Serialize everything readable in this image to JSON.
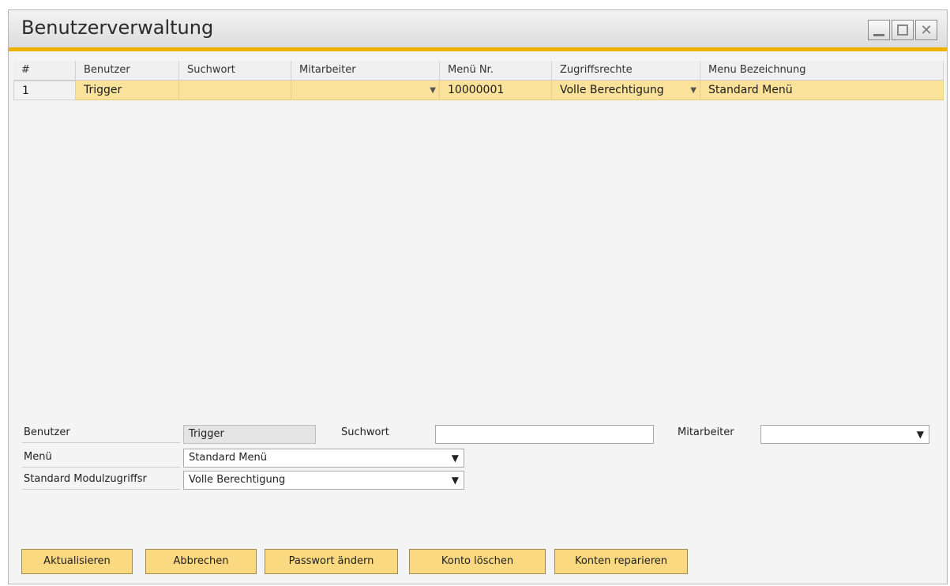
{
  "window": {
    "title": "Benutzerverwaltung",
    "controls": [
      "minimize-icon",
      "maximize-icon",
      "close-icon"
    ],
    "accent_color": "#f0b000"
  },
  "grid": {
    "columns": [
      "#",
      "Benutzer",
      "Suchwort",
      "Mitarbeiter",
      "Menü Nr.",
      "Zugriffsrechte",
      "Menu Bezeichnung"
    ],
    "rows": [
      [
        "1",
        "Trigger",
        "",
        "",
        "10000001",
        "Volle Berechtigung",
        "Standard Menü"
      ]
    ],
    "selected_row_color": "#fbe29b"
  },
  "form": {
    "benutzer_label": "Benutzer",
    "benutzer_value": "Trigger",
    "suchwort_label": "Suchwort",
    "suchwort_value": "",
    "mitarbeiter_label": "Mitarbeiter",
    "mitarbeiter_value": "",
    "menu_label": "Menü",
    "menu_value": "Standard Menü",
    "modulzugriff_label": "Standard Modulzugriffsr",
    "modulzugriff_value": "Volle Berechtigung"
  },
  "buttons": {
    "update": "Aktualisieren",
    "cancel": "Abbrechen",
    "change_password": "Passwort ändern",
    "delete_account": "Konto löschen",
    "repair_accounts": "Konten reparieren"
  }
}
